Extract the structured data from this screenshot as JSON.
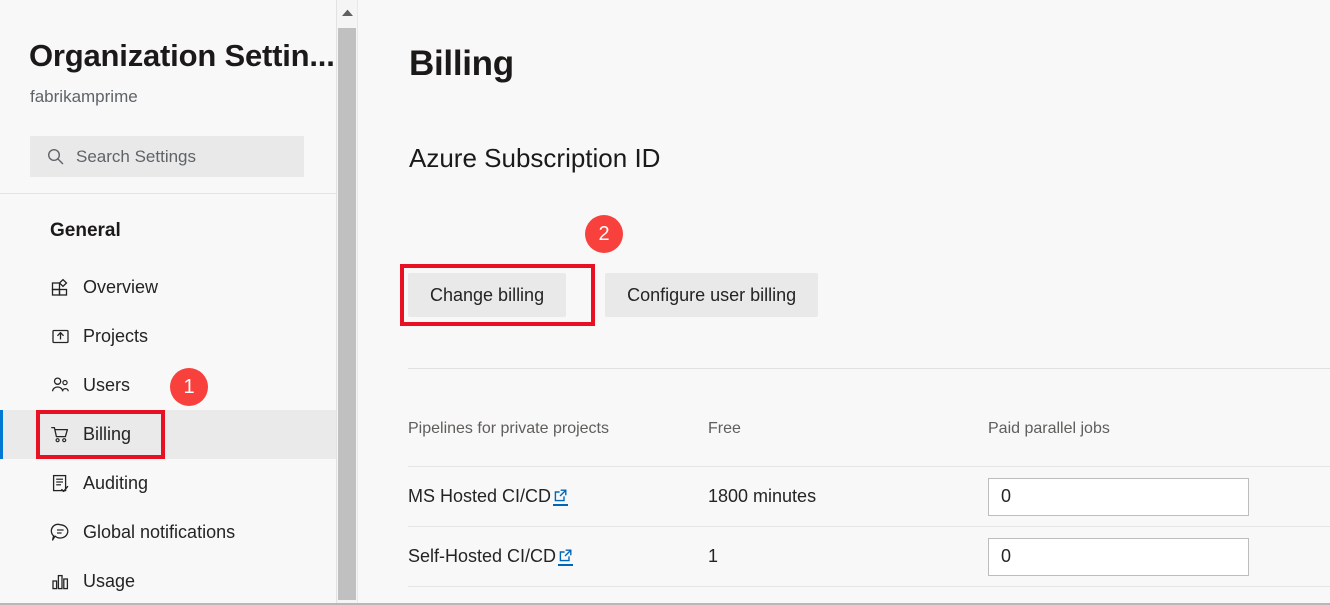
{
  "sidebar": {
    "org_title": "Organization Settin...",
    "org_name": "fabrikamprime",
    "search": {
      "placeholder": "Search Settings",
      "value": "",
      "icon": "search-icon"
    },
    "group_label": "General",
    "items": [
      {
        "label": "Overview",
        "icon": "overview-grid-icon",
        "selected": false
      },
      {
        "label": "Projects",
        "icon": "projects-upload-box-icon",
        "selected": false
      },
      {
        "label": "Users",
        "icon": "users-people-icon",
        "selected": false
      },
      {
        "label": "Billing",
        "icon": "billing-cart-icon",
        "selected": true
      },
      {
        "label": "Auditing",
        "icon": "auditing-clipboard-check-icon",
        "selected": false
      },
      {
        "label": "Global notifications",
        "icon": "notifications-speech-bubble-icon",
        "selected": false
      },
      {
        "label": "Usage",
        "icon": "usage-bar-chart-icon",
        "selected": false
      }
    ],
    "scrollbar": {
      "up_arrow_icon": "chevron-up-icon"
    }
  },
  "main": {
    "page_title": "Billing",
    "section_title": "Azure Subscription ID",
    "buttons": {
      "change_billing": "Change billing",
      "configure_user_billing": "Configure user billing"
    },
    "table": {
      "headers": [
        "Pipelines for private projects",
        "Free",
        "Paid parallel jobs"
      ],
      "rows": [
        {
          "name": "MS Hosted CI/CD",
          "link_icon": "external-link-icon",
          "free": "1800 minutes",
          "paid_parallel_jobs": "0"
        },
        {
          "name": "Self-Hosted CI/CD",
          "link_icon": "external-link-icon",
          "free": "1",
          "paid_parallel_jobs": "0"
        }
      ]
    }
  },
  "annotations": {
    "badge_1": "1",
    "badge_2": "2",
    "box_color": "#E81123",
    "badge_color": "#F8403C"
  },
  "colors": {
    "accent": "#0078D4",
    "link": "#0067B8",
    "selected_row_bg": "#EAEAEA",
    "page_bg": "#F8F8F8"
  }
}
